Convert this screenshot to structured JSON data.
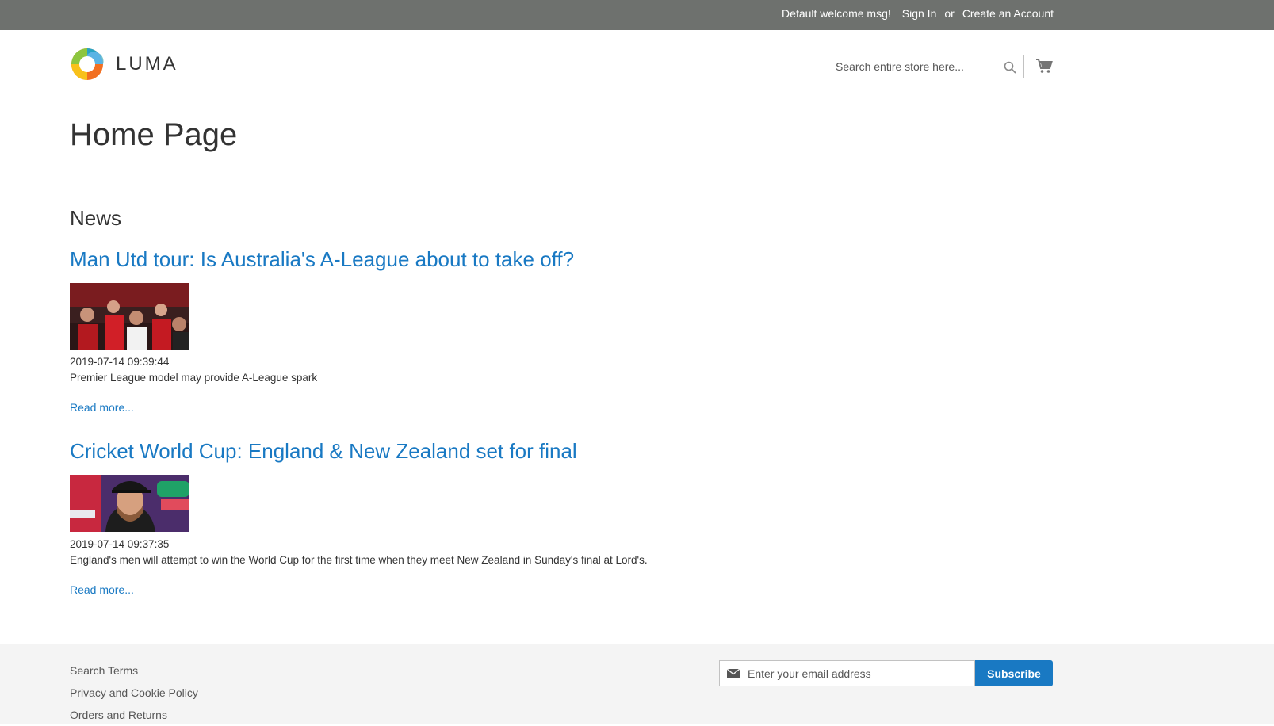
{
  "topbar": {
    "welcome": "Default welcome msg!",
    "sign_in": "Sign In",
    "or": "or",
    "create_account": "Create an Account"
  },
  "header": {
    "logo_text": "LUMA",
    "search_placeholder": "Search entire store here...",
    "search_value": ""
  },
  "page": {
    "title": "Home Page",
    "news_heading": "News"
  },
  "articles": [
    {
      "title": "Man Utd tour: Is Australia's A-League about to take off?",
      "date": "2019-07-14 09:39:44",
      "excerpt": "Premier League model may provide A-League spark",
      "read_more": "Read more..."
    },
    {
      "title": "Cricket World Cup: England & New Zealand set for final",
      "date": "2019-07-14 09:37:35",
      "excerpt": "England's men will attempt to win the World Cup for the first time when they meet New Zealand in Sunday's final at Lord's.",
      "read_more": "Read more..."
    }
  ],
  "footer": {
    "links": [
      "Search Terms",
      "Privacy and Cookie Policy",
      "Orders and Returns"
    ],
    "newsletter_placeholder": "Enter your email address",
    "subscribe_label": "Subscribe"
  },
  "colors": {
    "topbar": "#6e716e",
    "link": "#1979c3",
    "footer_bg": "#f4f4f4"
  },
  "icons": [
    "luma-logo-icon",
    "search-icon",
    "cart-icon",
    "envelope-icon"
  ]
}
